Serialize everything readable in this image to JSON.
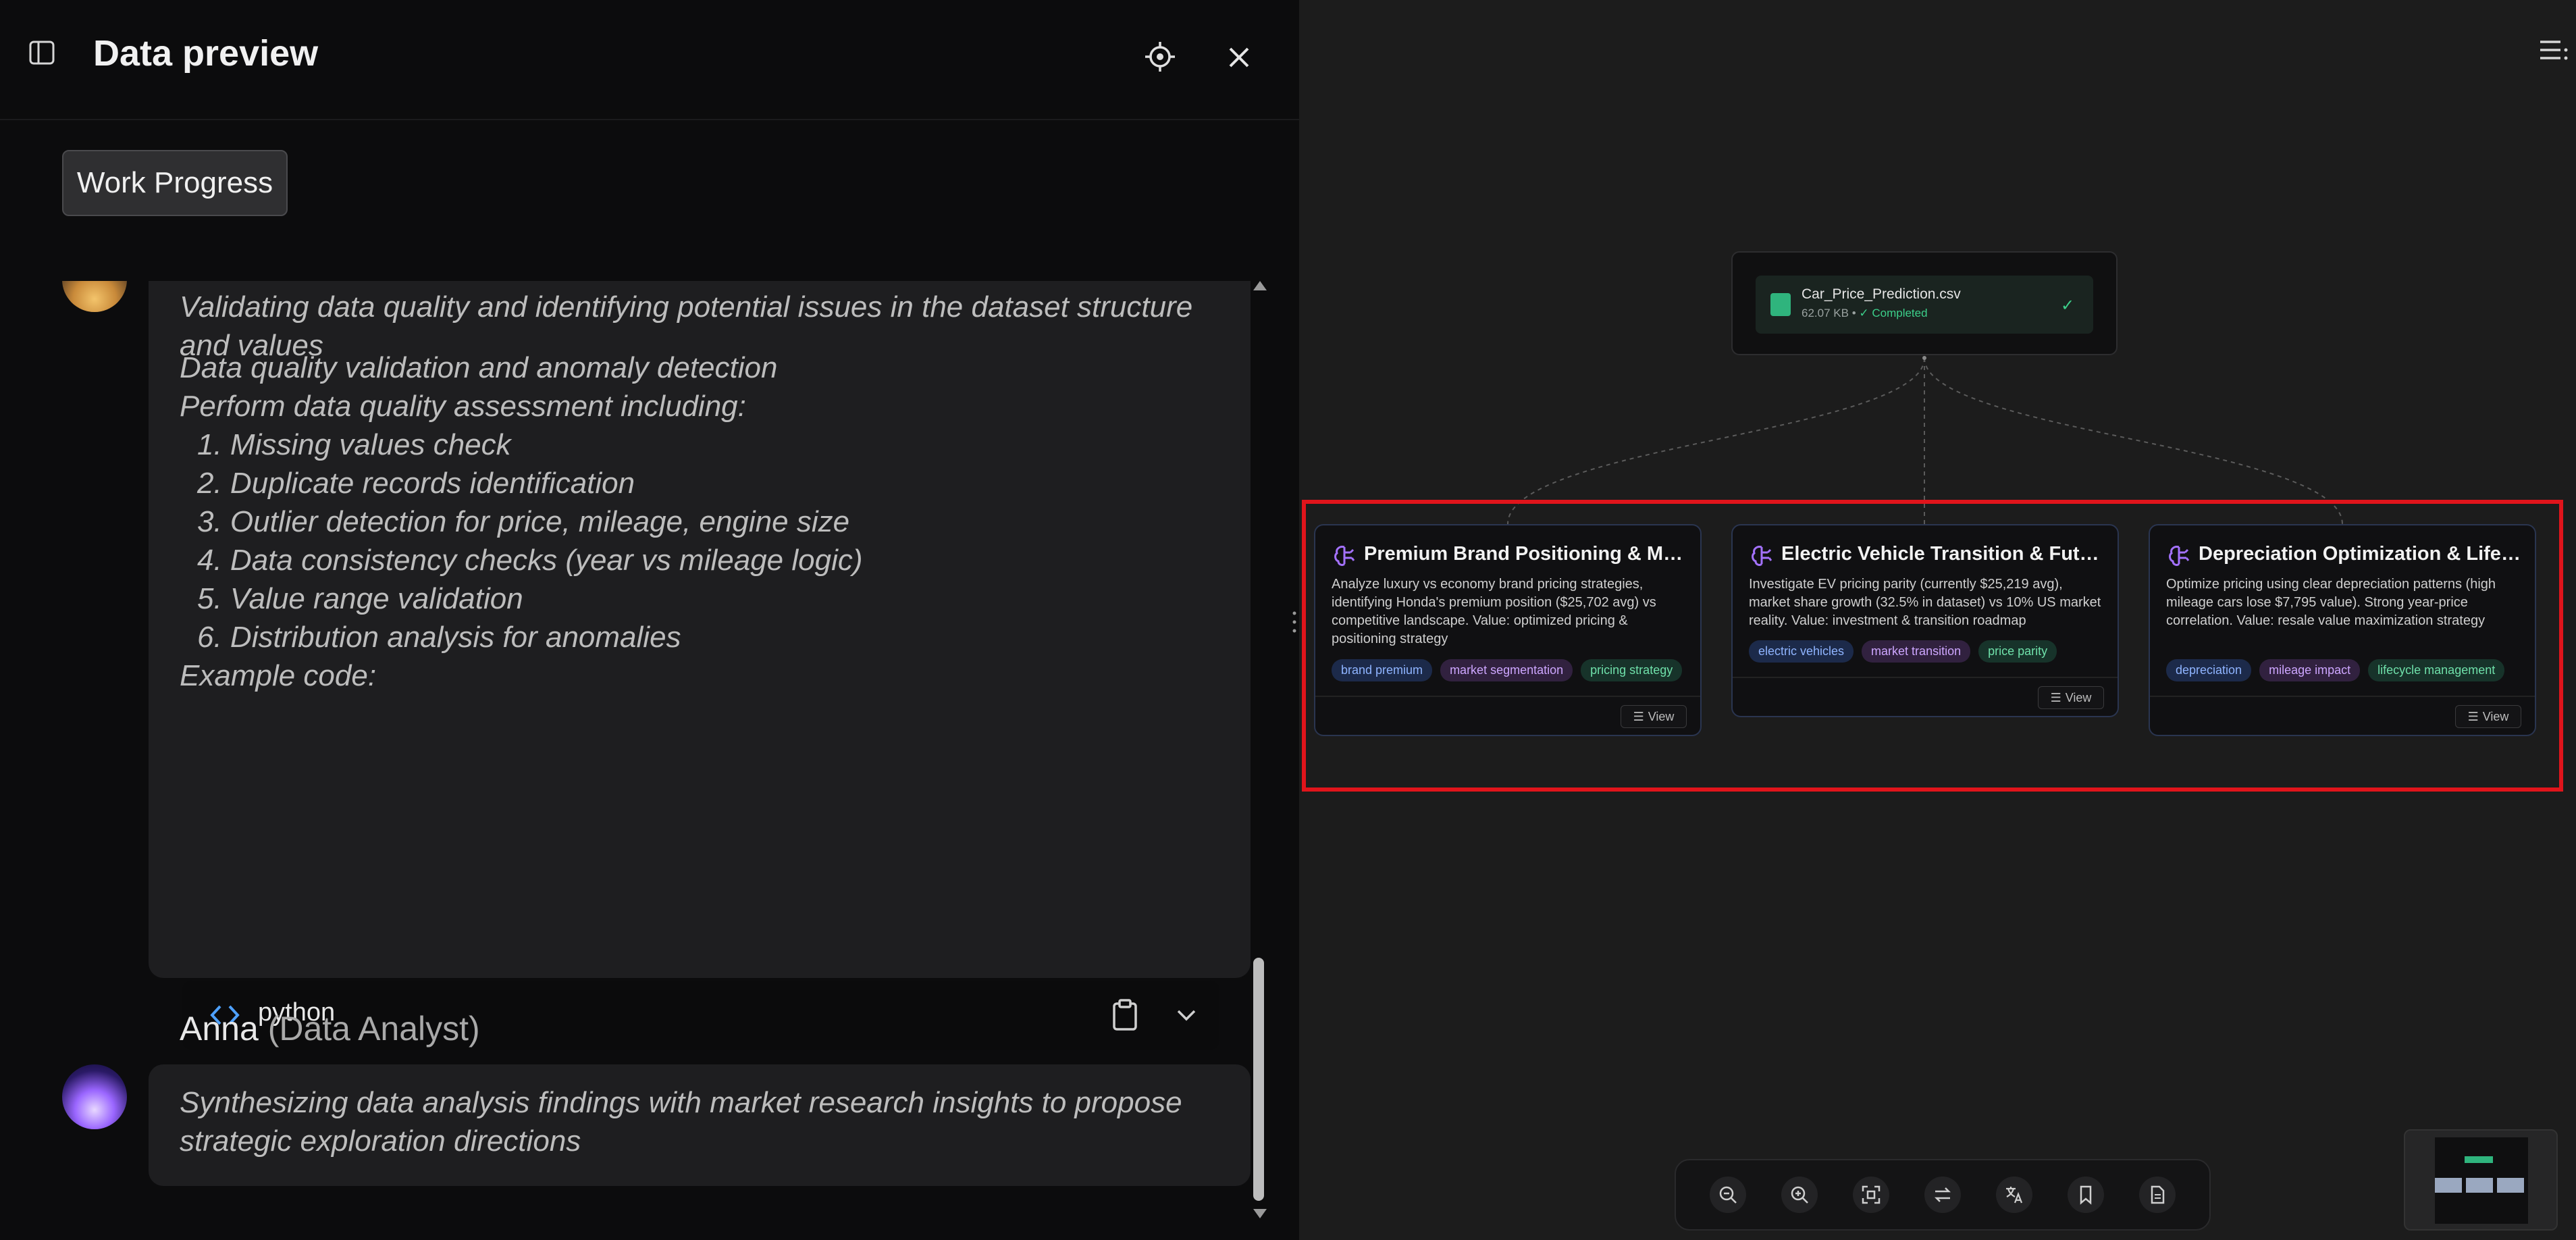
{
  "left_panel": {
    "title": "Data preview",
    "work_progress_label": "Work Progress",
    "message1": {
      "status": "Validating data quality and identifying potential issues in the dataset structure and values",
      "heading": "Data quality validation and anomaly detection",
      "intro": "Perform data quality assessment including:",
      "steps": [
        "1. Missing values check",
        "2. Duplicate records identification",
        "3. Outlier detection for price, mileage, engine size",
        "4. Data consistency checks (year vs mileage logic)",
        "5. Value range validation",
        "6. Distribution analysis for anomalies"
      ],
      "example_label": "Example code:",
      "code_blocks": [
        {
          "language": "python"
        },
        {
          "language": "python"
        }
      ]
    },
    "agent": {
      "name": "Anna",
      "role": "(Data Analyst)"
    },
    "message2": {
      "status": "Synthesizing data analysis findings with market research insights to propose strategic exploration directions"
    }
  },
  "canvas": {
    "file_node": {
      "name": "Car_Price_Prediction.csv",
      "size": "62.07 KB",
      "separator": "•",
      "status": "✓ Completed"
    },
    "cards": [
      {
        "title": "Premium Brand Positioning & Mar...",
        "description": "Analyze luxury vs economy brand pricing strategies, identifying Honda's premium position ($25,702 avg) vs competitive landscape. Value: optimized pricing & positioning strategy",
        "tags": [
          {
            "label": "brand premium",
            "color": "blue"
          },
          {
            "label": "market segmentation",
            "color": "purple"
          },
          {
            "label": "pricing strategy",
            "color": "green"
          }
        ],
        "view_label": "View"
      },
      {
        "title": "Electric Vehicle Transition & Future...",
        "description": "Investigate EV pricing parity (currently $25,219 avg), market share growth (32.5% in dataset) vs 10% US market reality. Value: investment & transition roadmap",
        "tags": [
          {
            "label": "electric vehicles",
            "color": "blue"
          },
          {
            "label": "market transition",
            "color": "purple"
          },
          {
            "label": "price parity",
            "color": "green"
          }
        ],
        "view_label": "View"
      },
      {
        "title": "Depreciation Optimization & Lifec...",
        "description": "Optimize pricing using clear depreciation patterns (high mileage cars lose $7,795 value). Strong year-price correlation. Value: resale value maximization strategy",
        "tags": [
          {
            "label": "depreciation",
            "color": "blue"
          },
          {
            "label": "mileage impact",
            "color": "purple"
          },
          {
            "label": "lifecycle management",
            "color": "green"
          }
        ],
        "view_label": "View"
      }
    ],
    "toolbar_icons": [
      "zoom-out-icon",
      "zoom-in-icon",
      "fit-view-icon",
      "swap-icon",
      "translate-icon",
      "bookmark-icon",
      "document-icon"
    ]
  },
  "colors": {
    "selection_border": "#e0141b",
    "accent_green": "#3ccf8a",
    "accent_purple": "#a472ff"
  }
}
